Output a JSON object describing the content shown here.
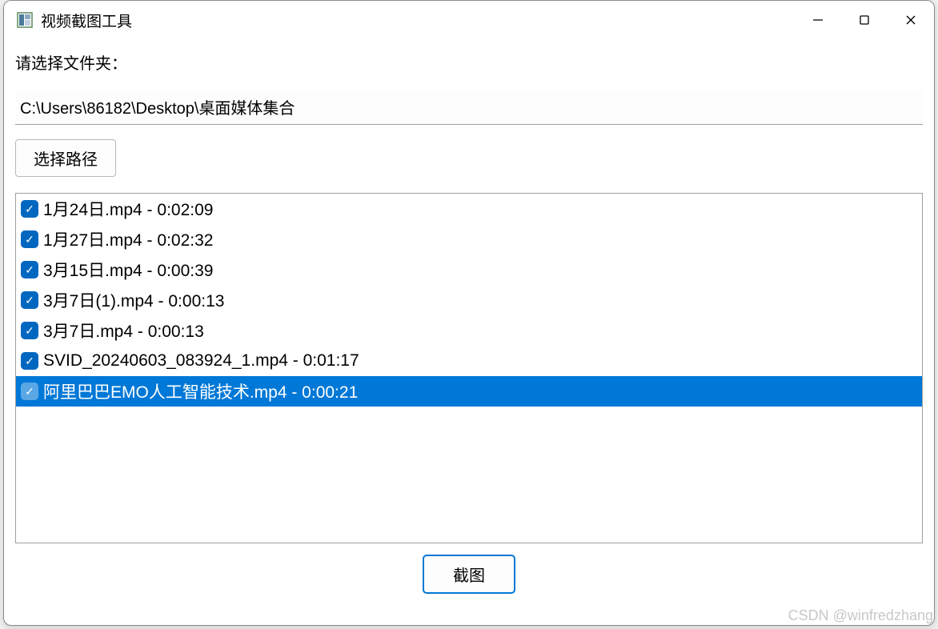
{
  "window": {
    "title": "视频截图工具"
  },
  "form": {
    "folder_label": "请选择文件夹：",
    "path_value": "C:\\Users\\86182\\Desktop\\桌面媒体集合",
    "select_path_button": "选择路径",
    "screenshot_button": "截图"
  },
  "files": [
    {
      "name": "1月24日.mp4",
      "duration": "0:02:09",
      "checked": true,
      "selected": false
    },
    {
      "name": "1月27日.mp4",
      "duration": "0:02:32",
      "checked": true,
      "selected": false
    },
    {
      "name": "3月15日.mp4",
      "duration": "0:00:39",
      "checked": true,
      "selected": false
    },
    {
      "name": "3月7日(1).mp4",
      "duration": "0:00:13",
      "checked": true,
      "selected": false
    },
    {
      "name": "3月7日.mp4",
      "duration": "0:00:13",
      "checked": true,
      "selected": false
    },
    {
      "name": "SVID_20240603_083924_1.mp4",
      "duration": "0:01:17",
      "checked": true,
      "selected": false
    },
    {
      "name": "阿里巴巴EMO人工智能技术.mp4",
      "duration": "0:00:21",
      "checked": true,
      "selected": true
    }
  ],
  "watermark": "CSDN @winfredzhang"
}
